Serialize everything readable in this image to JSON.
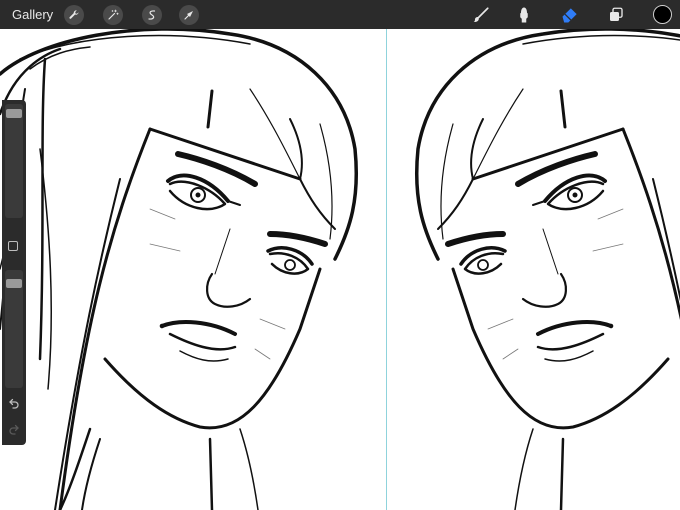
{
  "toolbar": {
    "gallery_label": "Gallery",
    "left_tools": [
      "wrench-icon",
      "magic-wand-icon",
      "selection-icon",
      "transform-arrow-icon"
    ],
    "right_tools": [
      "brush-icon",
      "smudge-icon",
      "eraser-icon",
      "layers-icon"
    ],
    "active_tool": "eraser",
    "accent_color": "#2f7cf6",
    "current_color": "#000000"
  },
  "sidebar": {
    "brush_size_level": 0.95,
    "opacity_level": 0.92,
    "icons": [
      "modify-square-icon",
      "undo-icon",
      "redo-icon"
    ]
  },
  "canvas": {
    "symmetry_guide": "vertical",
    "guide_color": "#8fd3dc"
  }
}
